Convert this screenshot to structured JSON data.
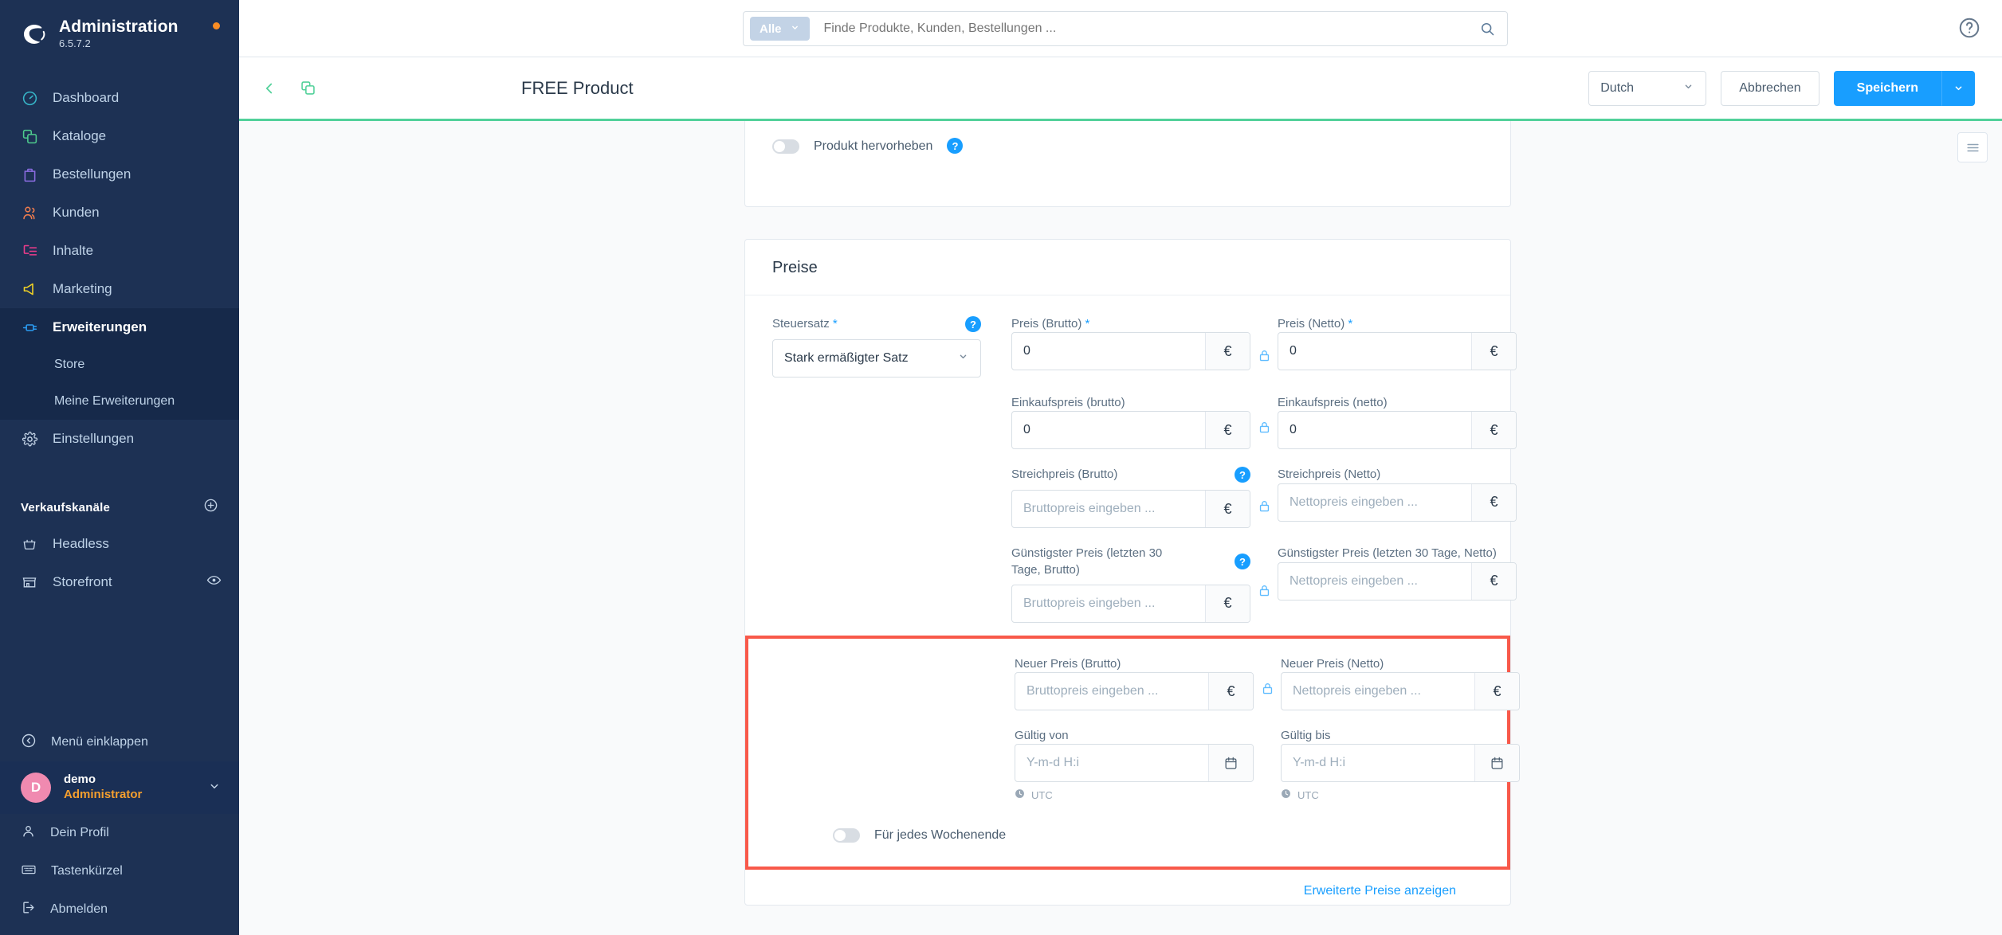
{
  "sidebar": {
    "brand": {
      "title": "Administration",
      "version": "6.5.7.2",
      "logo_icon": "shopware-logo-icon",
      "status_dot": "notification-dot"
    },
    "items": [
      {
        "label": "Dashboard",
        "icon": "dashboard-icon",
        "color": "#37b5c8"
      },
      {
        "label": "Kataloge",
        "icon": "catalog-icon",
        "color": "#4ecb8d"
      },
      {
        "label": "Bestellungen",
        "icon": "orders-bag-icon",
        "color": "#8a6ce0"
      },
      {
        "label": "Kunden",
        "icon": "customers-icon",
        "color": "#ee7c4e"
      },
      {
        "label": "Inhalte",
        "icon": "content-icon",
        "color": "#ee3c8b"
      },
      {
        "label": "Marketing",
        "icon": "megaphone-icon",
        "color": "#f2d325"
      },
      {
        "label": "Erweiterungen",
        "icon": "plugin-icon",
        "color": "#2b9cf2"
      }
    ],
    "extensions_sub": [
      {
        "label": "Store"
      },
      {
        "label": "Meine Erweiterungen"
      }
    ],
    "settings": {
      "label": "Einstellungen",
      "icon": "gear-icon"
    },
    "sales_channels": {
      "title": "Verkaufskanäle",
      "add_icon": "plus-circle-icon",
      "items": [
        {
          "label": "Headless",
          "icon": "basket-icon",
          "trailing_icon": ""
        },
        {
          "label": "Storefront",
          "icon": "storefront-icon",
          "trailing_icon": "eye-icon"
        }
      ]
    },
    "collapse": {
      "label": "Menü einklappen",
      "icon": "chevron-left-circle-icon"
    },
    "user": {
      "initial": "D",
      "name": "demo",
      "role": "Administrator",
      "chevron_icon": "chevron-down-icon"
    },
    "footer_items": [
      {
        "label": "Dein Profil",
        "icon": "user-icon"
      },
      {
        "label": "Tastenkürzel",
        "icon": "keyboard-icon"
      },
      {
        "label": "Abmelden",
        "icon": "logout-icon"
      }
    ]
  },
  "topbar": {
    "scope_label": "Alle",
    "scope_chevron_icon": "chevron-down-icon",
    "search_placeholder": "Finde Produkte, Kunden, Bestellungen ...",
    "search_icon": "search-icon",
    "help_icon": "help-circle-icon"
  },
  "smartbar": {
    "back_icon": "chevron-left-icon",
    "duplicate_icon": "duplicate-icon",
    "title": "FREE Product",
    "language": "Dutch",
    "language_chevron_icon": "chevron-down-icon",
    "cancel_label": "Abbrechen",
    "save_label": "Speichern",
    "save_split_icon": "chevron-down-icon",
    "accent_color": "#52d19a"
  },
  "content": {
    "panel_toggle_icon": "list-panel-icon",
    "feature_card": {
      "toggle_label": "Produkt hervorheben",
      "toggle_on": false,
      "hint_icon": "question-mark-icon"
    },
    "prices_card": {
      "heading": "Preise",
      "tax": {
        "label": "Steuersatz",
        "required": true,
        "hint_icon": "question-mark-icon",
        "value": "Stark ermäßigter Satz",
        "chevron_icon": "chevron-down-icon"
      },
      "rows": [
        {
          "gross": {
            "label": "Preis (Brutto)",
            "required": true,
            "value": "0",
            "placeholder": "",
            "suffix": "€"
          },
          "net": {
            "label": "Preis (Netto)",
            "required": true,
            "value": "0",
            "placeholder": "",
            "suffix": "€"
          },
          "lock_icon": "lock-icon",
          "hint_icon": ""
        },
        {
          "gross": {
            "label": "Einkaufspreis (brutto)",
            "required": false,
            "value": "0",
            "placeholder": "",
            "suffix": "€"
          },
          "net": {
            "label": "Einkaufspreis (netto)",
            "required": false,
            "value": "0",
            "placeholder": "",
            "suffix": "€"
          },
          "lock_icon": "lock-icon",
          "hint_icon": ""
        },
        {
          "gross": {
            "label": "Streichpreis (Brutto)",
            "required": false,
            "value": "",
            "placeholder": "Bruttopreis eingeben ...",
            "suffix": "€"
          },
          "net": {
            "label": "Streichpreis (Netto)",
            "required": false,
            "value": "",
            "placeholder": "Nettopreis eingeben ...",
            "suffix": "€"
          },
          "lock_icon": "lock-icon",
          "hint_icon": "question-mark-icon"
        },
        {
          "gross": {
            "label": "Günstigster Preis (letzten 30 Tage, Brutto)",
            "required": false,
            "value": "",
            "placeholder": "Bruttopreis eingeben ...",
            "suffix": "€"
          },
          "net": {
            "label": "Günstigster Preis (letzten 30 Tage, Netto)",
            "required": false,
            "value": "",
            "placeholder": "Nettopreis eingeben ...",
            "suffix": "€"
          },
          "lock_icon": "lock-icon",
          "hint_icon": "question-mark-icon"
        }
      ],
      "highlighted": {
        "border_color": "#f8594a",
        "new_price": {
          "gross": {
            "label": "Neuer Preis (Brutto)",
            "value": "",
            "placeholder": "Bruttopreis eingeben ...",
            "suffix": "€"
          },
          "net": {
            "label": "Neuer Preis (Netto)",
            "value": "",
            "placeholder": "Nettopreis eingeben ...",
            "suffix": "€"
          },
          "lock_icon": "lock-icon"
        },
        "valid_from": {
          "label": "Gültig von",
          "value": "",
          "placeholder": "Y-m-d H:i",
          "icon": "calendar-icon",
          "timezone": "UTC",
          "tz_icon": "clock-icon"
        },
        "valid_to": {
          "label": "Gültig bis",
          "value": "",
          "placeholder": "Y-m-d H:i",
          "icon": "calendar-icon",
          "timezone": "UTC",
          "tz_icon": "clock-icon"
        },
        "weekend_toggle": {
          "label": "Für jedes Wochenende",
          "on": false
        }
      },
      "footer_link": "Erweiterte Preise anzeigen"
    }
  }
}
